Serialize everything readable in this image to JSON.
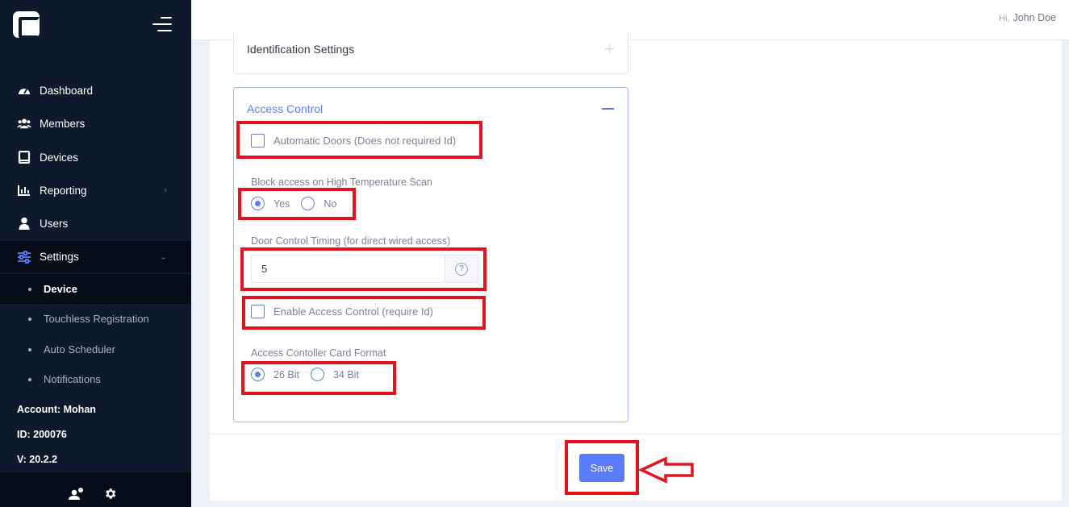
{
  "sidebar": {
    "nav": [
      {
        "label": "Dashboard",
        "icon": "dashboard-icon"
      },
      {
        "label": "Members",
        "icon": "members-icon"
      },
      {
        "label": "Devices",
        "icon": "devices-icon"
      },
      {
        "label": "Reporting",
        "icon": "reporting-icon",
        "chevron": "›"
      },
      {
        "label": "Users",
        "icon": "user-icon"
      },
      {
        "label": "Settings",
        "icon": "settings-sliders-icon",
        "chevron": "⌄"
      }
    ],
    "sub": [
      {
        "label": "Device",
        "active": true
      },
      {
        "label": "Touchless Registration"
      },
      {
        "label": "Auto Scheduler"
      },
      {
        "label": "Notifications"
      }
    ],
    "account": "Account: Mohan",
    "id": "ID: 200076",
    "version": "V: 20.2.2"
  },
  "topbar": {
    "hi": "Hi,",
    "user": "John Doe"
  },
  "identification": {
    "title": "Identification Settings",
    "toggle": "+"
  },
  "access_control": {
    "title": "Access Control",
    "automatic_doors": "Automatic Doors (Does not required Id)",
    "block_access_label": "Block access on High Temperature Scan",
    "block_yes": "Yes",
    "block_no": "No",
    "door_timing_label": "Door Control Timing (for direct wired access)",
    "door_timing_value": "5",
    "help": "?",
    "enable_access": "Enable Access Control (require Id)",
    "card_format_label": "Access Contoller Card Format",
    "card_26": "26 Bit",
    "card_34": "34 Bit"
  },
  "save_label": "Save",
  "colors": {
    "accent": "#5b7cfa",
    "sidebar": "#0e1a2b",
    "highlight": "#e0141e"
  }
}
